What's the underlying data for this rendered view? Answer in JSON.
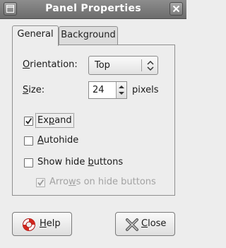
{
  "window": {
    "title": "Panel Properties"
  },
  "tabs": [
    {
      "label": "General",
      "active": true
    },
    {
      "label": "Background",
      "active": false
    }
  ],
  "orientation": {
    "label_mnemonic": "O",
    "label_rest": "rientation:",
    "value": "Top"
  },
  "size": {
    "label_mnemonic": "S",
    "label_rest": "ize:",
    "value": "24",
    "unit": "pixels"
  },
  "expand": {
    "label_pre": "Ex",
    "label_mnemonic": "p",
    "label_post": "and",
    "checked": true
  },
  "autohide": {
    "label_mnemonic": "A",
    "label_rest": "utohide",
    "checked": false
  },
  "show_hide_buttons": {
    "label_pre": "Show hide ",
    "label_mnemonic": "b",
    "label_post": "uttons",
    "checked": false
  },
  "arrows_on_hide_buttons": {
    "label_pre": "Arro",
    "label_mnemonic": "w",
    "label_post": "s on hide buttons",
    "checked": true,
    "enabled": false
  },
  "buttons": {
    "help": {
      "mnemonic": "H",
      "rest": "elp",
      "icon": "lifebuoy-icon"
    },
    "close": {
      "mnemonic": "C",
      "rest": "lose",
      "icon": "close-x-icon"
    }
  },
  "colors": {
    "titlebar": "#7a7a7a",
    "background": "#ededed"
  }
}
